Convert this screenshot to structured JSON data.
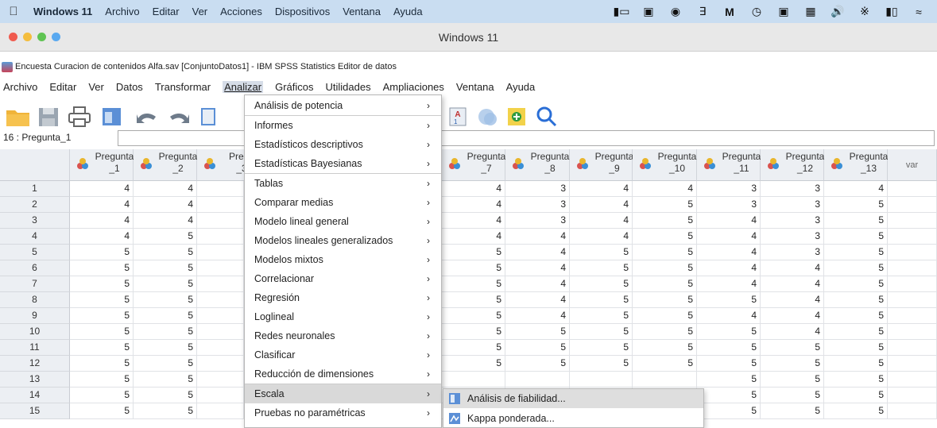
{
  "mac_menu": {
    "app_name": "Windows 11",
    "items": [
      "Archivo",
      "Editar",
      "Ver",
      "Acciones",
      "Dispositivos",
      "Ventana",
      "Ayuda"
    ]
  },
  "window": {
    "title": "Windows 11",
    "traffic_colors": [
      "#f05b4f",
      "#f4bd3d",
      "#5fc453",
      "#5aa9f0"
    ]
  },
  "spss": {
    "title": "Encuesta Curacion de contenidos Alfa.sav [ConjuntoDatos1] - IBM SPSS Statistics Editor de datos",
    "menu": [
      "Archivo",
      "Editar",
      "Ver",
      "Datos",
      "Transformar",
      "Analizar",
      "Gráficos",
      "Utilidades",
      "Ampliaciones",
      "Ventana",
      "Ayuda"
    ],
    "active_menu": "Analizar",
    "toolbar_icons": [
      "open-folder-icon",
      "save-icon",
      "print-icon",
      "dialog-recall-icon",
      "undo-icon",
      "redo-icon",
      "goto-case-icon",
      "insert-variable-icon",
      "split-file-icon",
      "weight-cases-icon",
      "select-cases-icon",
      "search-icon"
    ]
  },
  "var_indicator": {
    "name": "16 : Pregunta_1",
    "value": ""
  },
  "grid": {
    "columns_left": [
      {
        "top": "Pregunta",
        "bottom": "_1"
      },
      {
        "top": "Pregunta",
        "bottom": "_2"
      },
      {
        "top": "Pregu",
        "bottom": "_3"
      }
    ],
    "columns_right": [
      {
        "top": "Pregunta",
        "bottom": "_7"
      },
      {
        "top": "Pregunta",
        "bottom": "_8"
      },
      {
        "top": "Pregunta",
        "bottom": "_9"
      },
      {
        "top": "Pregunta",
        "bottom": "_10"
      },
      {
        "top": "Pregunta",
        "bottom": "_11"
      },
      {
        "top": "Pregunta",
        "bottom": "_12"
      },
      {
        "top": "Pregunta",
        "bottom": "_13"
      }
    ],
    "var_header": "var",
    "row_numbers": [
      "1",
      "2",
      "3",
      "4",
      "5",
      "6",
      "7",
      "8",
      "9",
      "10",
      "11",
      "12",
      "13",
      "14",
      "15"
    ],
    "left_values": [
      [
        "4",
        "4"
      ],
      [
        "4",
        "4"
      ],
      [
        "4",
        "4"
      ],
      [
        "4",
        "5"
      ],
      [
        "5",
        "5"
      ],
      [
        "5",
        "5"
      ],
      [
        "5",
        "5"
      ],
      [
        "5",
        "5"
      ],
      [
        "5",
        "5"
      ],
      [
        "5",
        "5"
      ],
      [
        "5",
        "5"
      ],
      [
        "5",
        "5"
      ],
      [
        "5",
        "5"
      ],
      [
        "5",
        "5"
      ],
      [
        "5",
        "5"
      ]
    ],
    "right_values": [
      [
        "4",
        "3",
        "4",
        "4",
        "3",
        "3",
        "4"
      ],
      [
        "4",
        "3",
        "4",
        "5",
        "3",
        "3",
        "5"
      ],
      [
        "4",
        "3",
        "4",
        "5",
        "4",
        "3",
        "5"
      ],
      [
        "4",
        "4",
        "4",
        "5",
        "4",
        "3",
        "5"
      ],
      [
        "5",
        "4",
        "5",
        "5",
        "4",
        "3",
        "5"
      ],
      [
        "5",
        "4",
        "5",
        "5",
        "4",
        "4",
        "5"
      ],
      [
        "5",
        "4",
        "5",
        "5",
        "4",
        "4",
        "5"
      ],
      [
        "5",
        "4",
        "5",
        "5",
        "5",
        "4",
        "5"
      ],
      [
        "5",
        "4",
        "5",
        "5",
        "4",
        "4",
        "5"
      ],
      [
        "5",
        "5",
        "5",
        "5",
        "5",
        "4",
        "5"
      ],
      [
        "5",
        "5",
        "5",
        "5",
        "5",
        "5",
        "5"
      ],
      [
        "5",
        "5",
        "5",
        "5",
        "5",
        "5",
        "5"
      ],
      [
        "",
        "",
        "",
        "",
        "5",
        "5",
        "5"
      ],
      [
        "",
        "",
        "",
        "",
        "5",
        "5",
        "5"
      ],
      [
        "",
        "",
        "",
        "",
        "5",
        "5",
        "5"
      ]
    ]
  },
  "analizar_menu": {
    "items": [
      "Análisis de potencia",
      "Informes",
      "Estadísticos descriptivos",
      "Estadísticas Bayesianas",
      "Tablas",
      "Comparar medias",
      "Modelo lineal general",
      "Modelos lineales generalizados",
      "Modelos mixtos",
      "Correlacionar",
      "Regresión",
      "Loglineal",
      "Redes neuronales",
      "Clasificar",
      "Reducción de dimensiones",
      "Escala",
      "Pruebas no paramétricas"
    ],
    "highlighted": "Escala",
    "arrow": "›"
  },
  "escala_submenu": {
    "items": [
      "Análisis de fiabilidad...",
      "Kappa ponderada..."
    ],
    "highlighted": "Análisis de fiabilidad..."
  }
}
